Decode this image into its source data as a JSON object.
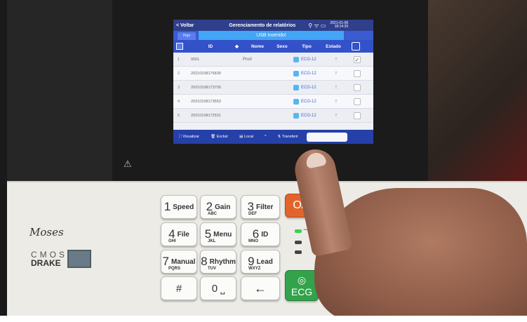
{
  "screen": {
    "back_label": "< Voltar",
    "title": "Gerenciamento de relatórios",
    "status_icons": "⚲ ᯤ ▭",
    "date": "2021-01-08",
    "time": "18:14:29",
    "tab_label": "Hoje",
    "usb_label": "USB inserido!",
    "columns": [
      "ID",
      "◆",
      "Nome",
      "Sexo",
      "Tipo",
      "Estado"
    ],
    "rows": [
      {
        "idx": "1",
        "id": "0001",
        "nome": "Prod",
        "tipo": "ECG-12",
        "checked": "✓"
      },
      {
        "idx": "2",
        "id": "20210108175839",
        "nome": "",
        "tipo": "ECG-12",
        "checked": ""
      },
      {
        "idx": "3",
        "id": "20210108173705",
        "nome": "",
        "tipo": "ECG-12",
        "checked": ""
      },
      {
        "idx": "4",
        "id": "20210108173553",
        "nome": "",
        "tipo": "ECG-12",
        "checked": ""
      },
      {
        "idx": "5",
        "id": "20210108172531",
        "nome": "",
        "tipo": "ECG-12",
        "checked": ""
      }
    ],
    "actions": {
      "visualizar": "⛶ Visualizar",
      "excluir": "🗑 Excluir",
      "local": "▤ Local",
      "up": "^",
      "transferir": "⇅ Transferir"
    }
  },
  "device": {
    "brand": "Moses",
    "cmos": "CMOS",
    "drake": "DRAKE"
  },
  "keys": {
    "k1": {
      "num": "1",
      "lbl": "Speed",
      "sub": ""
    },
    "k2": {
      "num": "2",
      "lbl": "Gain",
      "sub": "ABC"
    },
    "k3": {
      "num": "3",
      "lbl": "Filter",
      "sub": "DEF"
    },
    "k4": {
      "num": "4",
      "lbl": "File",
      "sub": "GHI"
    },
    "k5": {
      "num": "5",
      "lbl": "Menu",
      "sub": "JKL"
    },
    "k6": {
      "num": "6",
      "lbl": "ID",
      "sub": "MNO"
    },
    "k7": {
      "num": "7",
      "lbl": "Manual",
      "sub": "PQRS"
    },
    "k8": {
      "num": "8",
      "lbl": "Rhythm",
      "sub": "TUV"
    },
    "k9": {
      "num": "9",
      "lbl": "Lead",
      "sub": "WXYZ"
    },
    "hash": "#",
    "zero": "0 ⎵",
    "back": "←",
    "power": "O/Ó",
    "ecg_sym": "◎",
    "ecg": "ECG"
  },
  "indicators": {
    "ac": "~"
  },
  "colors": {
    "screen_header": "#2f3f8c",
    "usb_banner": "#42a5f5",
    "power_key": "#e2632c",
    "ecg_key": "#32a34a"
  }
}
